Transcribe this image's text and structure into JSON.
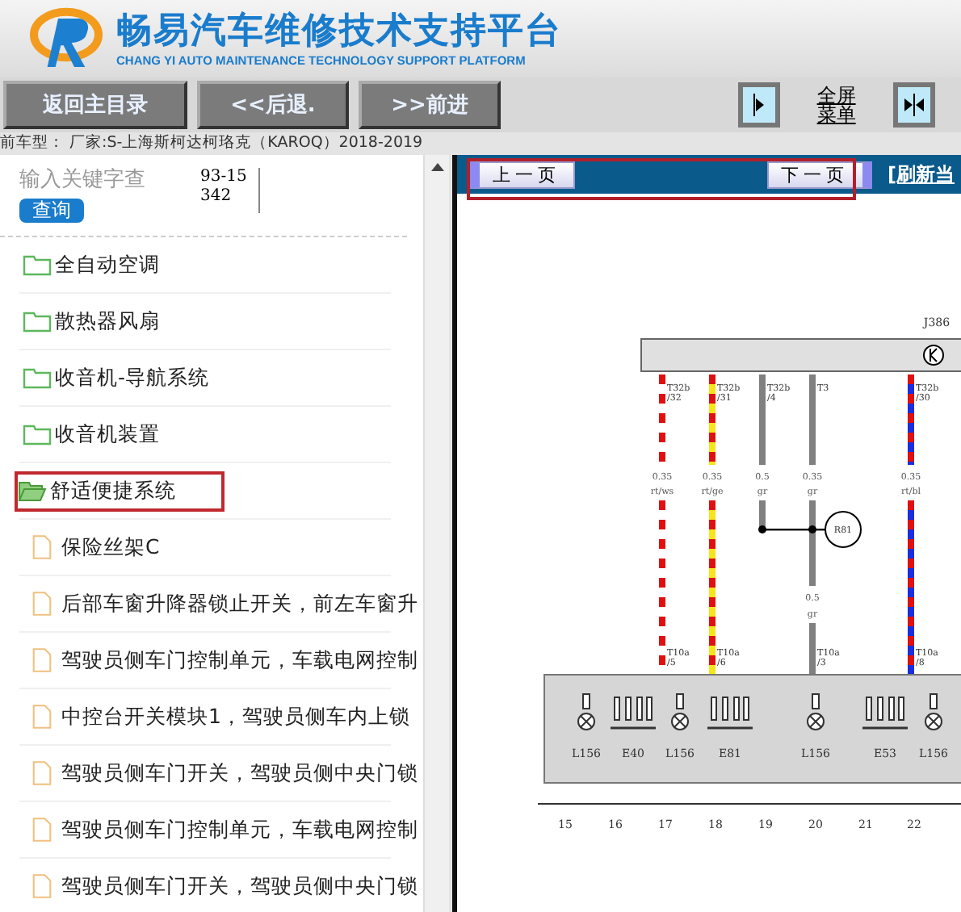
{
  "header": {
    "title": "畅易汽车维修技术支持平台",
    "subtitle": "CHANG YI AUTO MAINTENANCE TECHNOLOGY SUPPORT PLATFORM"
  },
  "nav_buttons": [
    "返回主目录",
    "<<后退.",
    ">>前进"
  ],
  "fullscreen_link": "全屏菜单",
  "model_line": "前车型：  厂家:S-上海斯柯达柯珞克（KAROQ）2018-2019",
  "search": {
    "placeholder": "输入关键字查",
    "button": "查询",
    "code": "93-15342"
  },
  "tree": [
    {
      "label": "全自动空调",
      "kind": "folder",
      "expanded": false,
      "selected": false
    },
    {
      "label": "散热器风扇",
      "kind": "folder",
      "expanded": false,
      "selected": false
    },
    {
      "label": "收音机-导航系统",
      "kind": "folder",
      "expanded": false,
      "selected": false
    },
    {
      "label": "收音机装置",
      "kind": "folder",
      "expanded": false,
      "selected": false
    },
    {
      "label": "舒适便捷系统",
      "kind": "folder",
      "expanded": true,
      "selected": true,
      "children": [
        {
          "label": "保险丝架C",
          "kind": "file",
          "selected": false
        },
        {
          "label": "后部车窗升降器锁止开关，前左车窗升",
          "kind": "file",
          "selected": false
        },
        {
          "label": "驾驶员侧车门控制单元，车载电网控制",
          "kind": "file",
          "selected": false
        },
        {
          "label": "中控台开关模块1，驾驶员侧车内上锁",
          "kind": "file",
          "selected": false
        },
        {
          "label": "驾驶员侧车门开关，驾驶员侧中央门锁",
          "kind": "file",
          "selected": false
        },
        {
          "label": "驾驶员侧车门控制单元，车载电网控制",
          "kind": "file",
          "selected": false
        },
        {
          "label": "驾驶员侧车门开关，驾驶员侧中央门锁",
          "kind": "file",
          "selected": false
        }
      ]
    }
  ],
  "viewer": {
    "prev": "上一页",
    "next": "下一页",
    "refresh": "[刷新当"
  },
  "diagram": {
    "module": "J386",
    "wires": [
      {
        "pin": "T32b /32",
        "gauge": "0.35",
        "code": "rt/ws",
        "color": "#e01010",
        "stripe": {
          "color": "#ffffff"
        },
        "bottom_pin": "T10a /5"
      },
      {
        "pin": "T32b /31",
        "gauge": "0.35",
        "code": "rt/ge",
        "color": "#e01010",
        "stripe": {
          "color": "#f5e51a"
        },
        "bottom_pin": "T10a /6"
      },
      {
        "pin": "T32b /4",
        "gauge": "0.5",
        "code": "gr",
        "color": "#808080"
      },
      {
        "pin": "T3",
        "gauge": "0.35",
        "code": "gr",
        "color": "#808080",
        "gauge2": "0.5",
        "code2": "gr",
        "bottom_pin": "T10a /3"
      },
      {
        "pin": "T32b /30",
        "gauge": "0.35",
        "code": "rt/bl",
        "color": "#e01010",
        "stripe": {
          "color": "#1a2ee0"
        },
        "bottom_pin": "T10a /8"
      }
    ],
    "resistor": "R81",
    "components": [
      {
        "label": "L156",
        "kind": "lamp"
      },
      {
        "label": "E40",
        "kind": "switch"
      },
      {
        "label": "L156",
        "kind": "lamp"
      },
      {
        "label": "E81",
        "kind": "switch"
      },
      {
        "label": "L156",
        "kind": "lamp"
      },
      {
        "label": "E53",
        "kind": "switch"
      },
      {
        "label": "L156",
        "kind": "lamp"
      }
    ],
    "columns": [
      "15",
      "16",
      "17",
      "18",
      "19",
      "20",
      "21",
      "22"
    ]
  }
}
